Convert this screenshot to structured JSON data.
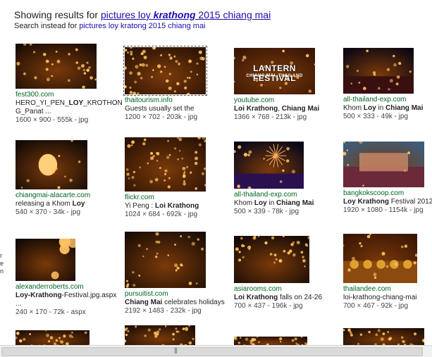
{
  "header": {
    "showing_prefix": "Showing results for ",
    "query_part1": "pictures loy ",
    "query_emph": "krathong",
    "query_part2": " 2015 chiang mai",
    "instead_prefix": "Search instead for ",
    "instead_link": "pictures loy kratong 2015 chiang mai"
  },
  "results": [
    {
      "source": "fest300.com",
      "desc_html": "HERO_YI_PEN_<b>LOY</b>_KROTHON",
      "desc2": "G_Panat ...",
      "meta": "1600 × 900 - 555k - jpg",
      "theme": "lanterns-warm"
    },
    {
      "source": "thaitourism.info",
      "desc_html": "Guests usually set the",
      "meta": "1200 × 702 - 203k - jpg",
      "theme": "lanterns-dense"
    },
    {
      "source": "youtube.com",
      "desc_html": "<b>Loi Krathong</b>, <b>Chiang Mai</b>",
      "meta": "1366 × 768 - 213k - jpg",
      "theme": "banner",
      "banner_title": "LANTERN FESTIVAL",
      "banner_sub": "CHIANG MAI, THAILAND"
    },
    {
      "source": "all-thailand-exp.com",
      "desc_html": "Khom <b>Loy</b> in <b>Chiang Mai</b>",
      "meta": "500 × 333 - 49k - jpg",
      "theme": "river"
    },
    {
      "source": "chiangmai-alacarte.com",
      "desc_html": "releasing a Khom <b>Loy</b>",
      "meta": "540 × 370 - 34k - jpg",
      "theme": "single"
    },
    {
      "source": "flickr.com",
      "desc_html": "Yi Peng : <b>Loi Krathong</b>",
      "meta": "1024 × 684 - 692k - jpg",
      "theme": "lanterns-dense"
    },
    {
      "source": "all-thailand-exp.com",
      "desc_html": "Khom <b>Loy</b> in <b>Chiang Mai</b>",
      "meta": "500 × 339 - 78k - jpg",
      "theme": "fireworks"
    },
    {
      "source": "bangkokscoop.com",
      "desc_html": "<b>Loy Krathong</b> Festival 2012",
      "meta": "1920 × 1080 - 1154k - jpg",
      "theme": "float"
    },
    {
      "source": "alexanderroberts.com",
      "desc_html": "<b>Loy-Krathong</b>-Festival.jpg.aspx ...",
      "meta": "240 × 170 - 72k - aspx",
      "theme": "large-lanterns"
    },
    {
      "source": "pursuitist.com",
      "desc_html": "<b>Chiang Mai</b> celebrates holidays",
      "meta": "2192 × 1483 - 232k - jpg",
      "theme": "lanterns-warm"
    },
    {
      "source": "asiarooms.com",
      "desc_html": "<b>Loi Krathong</b> falls on 24-26",
      "meta": "700 × 437 - 196k - jpg",
      "theme": "sky"
    },
    {
      "source": "thailandee.com",
      "desc_html": "loi-krathong-chiang-mai",
      "meta": "700 × 467 - 92k - jpg",
      "theme": "temple"
    }
  ],
  "edge_text": [
    "r",
    "e",
    "n"
  ],
  "scrollbar": {
    "grip": "|||"
  },
  "colors": {
    "link": "#1a0dab",
    "source": "#006621",
    "sky": "#0b0b1a",
    "glow": "#ffb347"
  }
}
